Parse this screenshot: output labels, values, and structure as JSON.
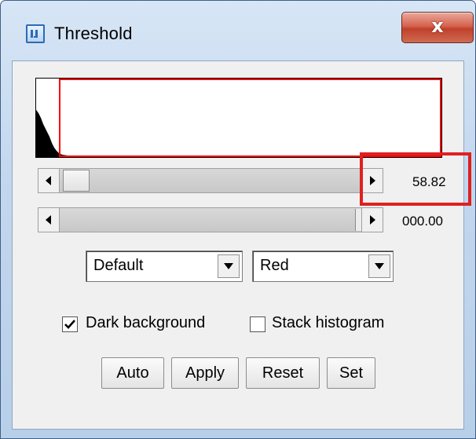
{
  "window": {
    "title": "Threshold",
    "close_glyph": "x",
    "icon": "imagej-icon"
  },
  "histogram": {
    "description_colors": {
      "bars": "#000000",
      "selection": "#ff0000"
    }
  },
  "sliders": {
    "lower": {
      "value_text": "58.82",
      "fraction": 0.09
    },
    "upper": {
      "value_text": "000.00",
      "fraction": 1.0
    }
  },
  "dropdowns": {
    "method": {
      "selected": "Default"
    },
    "display": {
      "selected": "Red"
    }
  },
  "checkboxes": {
    "dark_background": {
      "label": "Dark background",
      "checked": true
    },
    "stack_histogram": {
      "label": "Stack histogram",
      "checked": false
    }
  },
  "buttons": {
    "auto": "Auto",
    "apply": "Apply",
    "reset": "Reset",
    "set": "Set"
  },
  "colors": {
    "highlight": "#e02020",
    "close_button": "#c0412b"
  }
}
